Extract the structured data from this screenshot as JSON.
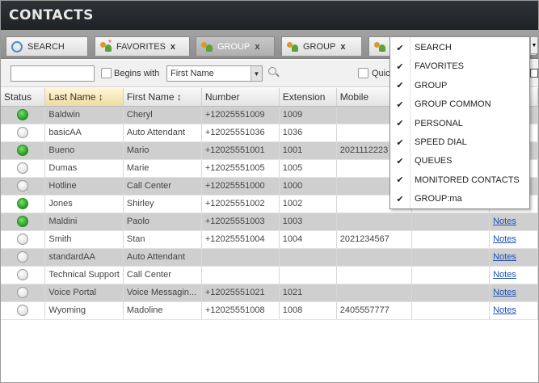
{
  "app": {
    "title": "CONTACTS"
  },
  "tabs": [
    {
      "label": "SEARCH",
      "icon": "search-icon",
      "closable": false
    },
    {
      "label": "FAVORITES",
      "icon": "favorites-icon",
      "closable": true,
      "close": "x"
    },
    {
      "label": "GROUP",
      "icon": "group-icon",
      "closable": true,
      "close": "x",
      "active": true
    },
    {
      "label": "GROUP",
      "icon": "group-icon",
      "closable": true,
      "close": "x"
    },
    {
      "label": "",
      "icon": "group-icon",
      "closable": false
    }
  ],
  "filter": {
    "search_value": "",
    "begins_with_label": "Begins with",
    "field_select": "First Name",
    "quick_label": "Quic"
  },
  "table": {
    "columns": [
      "Status",
      "Last Name",
      "First Name",
      "Number",
      "Extension",
      "Mobile",
      "",
      ""
    ],
    "sort_marker": "↕",
    "rows": [
      {
        "status": "available",
        "last": "Baldwin",
        "first": "Cheryl",
        "number": "+12025551009",
        "ext": "1009",
        "mobile": "",
        "notes": ""
      },
      {
        "status": "offline",
        "last": "basicAA",
        "first": "Auto Attendant",
        "number": "+12025551036",
        "ext": "1036",
        "mobile": "",
        "notes": ""
      },
      {
        "status": "available",
        "last": "Bueno",
        "first": "Mario",
        "number": "+12025551001",
        "ext": "1001",
        "mobile": "2021112223",
        "notes": ""
      },
      {
        "status": "offline",
        "last": "Dumas",
        "first": "Marie",
        "number": "+12025551005",
        "ext": "1005",
        "mobile": "",
        "notes": ""
      },
      {
        "status": "offline",
        "last": "Hotline",
        "first": "Call Center",
        "number": "+12025551000",
        "ext": "1000",
        "mobile": "",
        "notes": ""
      },
      {
        "status": "available",
        "last": "Jones",
        "first": "Shirley",
        "number": "+12025551002",
        "ext": "1002",
        "mobile": "",
        "notes": "Notes"
      },
      {
        "status": "available",
        "last": "Maldini",
        "first": "Paolo",
        "number": "+12025551003",
        "ext": "1003",
        "mobile": "",
        "notes": "Notes"
      },
      {
        "status": "offline",
        "last": "Smith",
        "first": "Stan",
        "number": "+12025551004",
        "ext": "1004",
        "mobile": "2021234567",
        "notes": "Notes"
      },
      {
        "status": "offline",
        "last": "standardAA",
        "first": "Auto Attendant",
        "number": "",
        "ext": "",
        "mobile": "",
        "notes": "Notes"
      },
      {
        "status": "offline",
        "last": "Technical Support",
        "first": "Call Center",
        "number": "",
        "ext": "",
        "mobile": "",
        "notes": "Notes"
      },
      {
        "status": "offline",
        "last": "Voice Portal",
        "first": "Voice Messagin...",
        "number": "+12025551021",
        "ext": "1021",
        "mobile": "",
        "notes": "Notes"
      },
      {
        "status": "offline",
        "last": "Wyoming",
        "first": "Madoline",
        "number": "+12025551008",
        "ext": "1008",
        "mobile": "2405557777",
        "notes": "Notes"
      }
    ]
  },
  "menu": {
    "items": [
      {
        "label": "SEARCH",
        "checked": true
      },
      {
        "label": "FAVORITES",
        "checked": true
      },
      {
        "label": "GROUP",
        "checked": true
      },
      {
        "label": "GROUP COMMON",
        "checked": true
      },
      {
        "label": "PERSONAL",
        "checked": true
      },
      {
        "label": "SPEED DIAL",
        "checked": true
      },
      {
        "label": "QUEUES",
        "checked": true
      },
      {
        "label": "MONITORED CONTACTS",
        "checked": true
      },
      {
        "label": "GROUP:ma",
        "checked": true
      }
    ],
    "check_glyph": "✔"
  },
  "colors": {
    "titlebar": "#2a2d31",
    "available": "#2fa52b",
    "notes_link": "#1d4fb3",
    "alt_row": "#cfcfcf"
  }
}
